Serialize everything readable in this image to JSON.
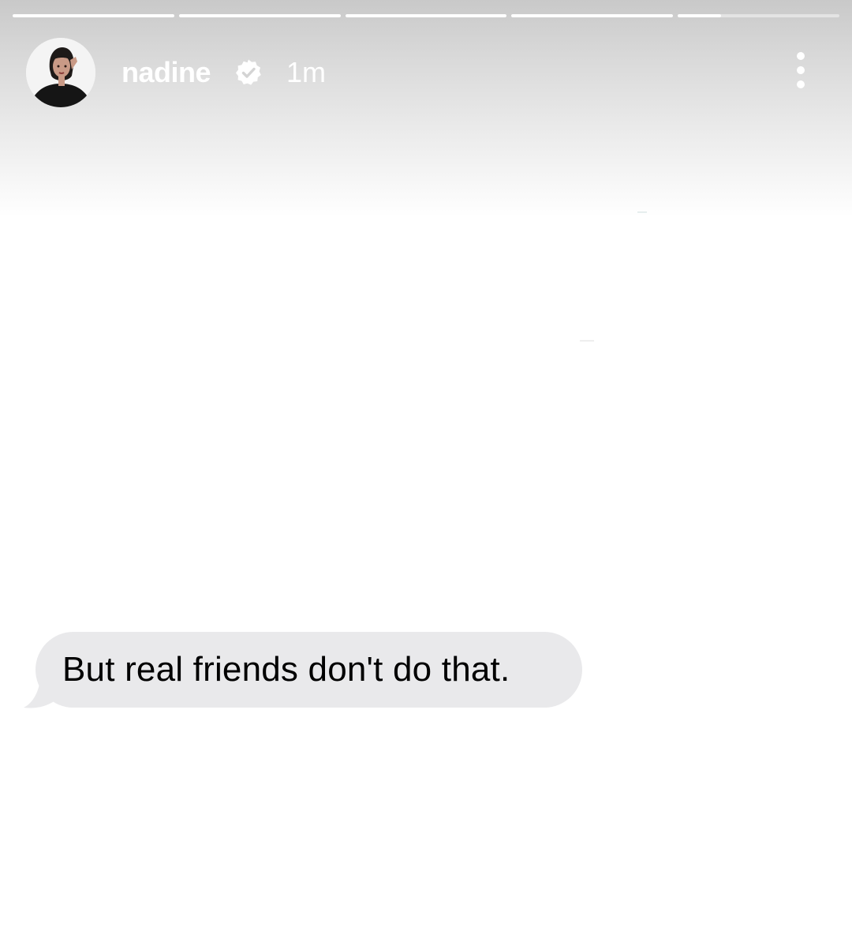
{
  "story": {
    "username": "nadine",
    "timestamp": "1m",
    "verified_icon": "verified-badge-icon",
    "more_icon": "more-options-icon",
    "progress_segments": [
      1,
      1,
      1,
      1,
      0.27
    ]
  },
  "message": {
    "text": "But real friends don't do that.",
    "bubble_color": "#e9e9eb",
    "text_color": "#000000"
  }
}
